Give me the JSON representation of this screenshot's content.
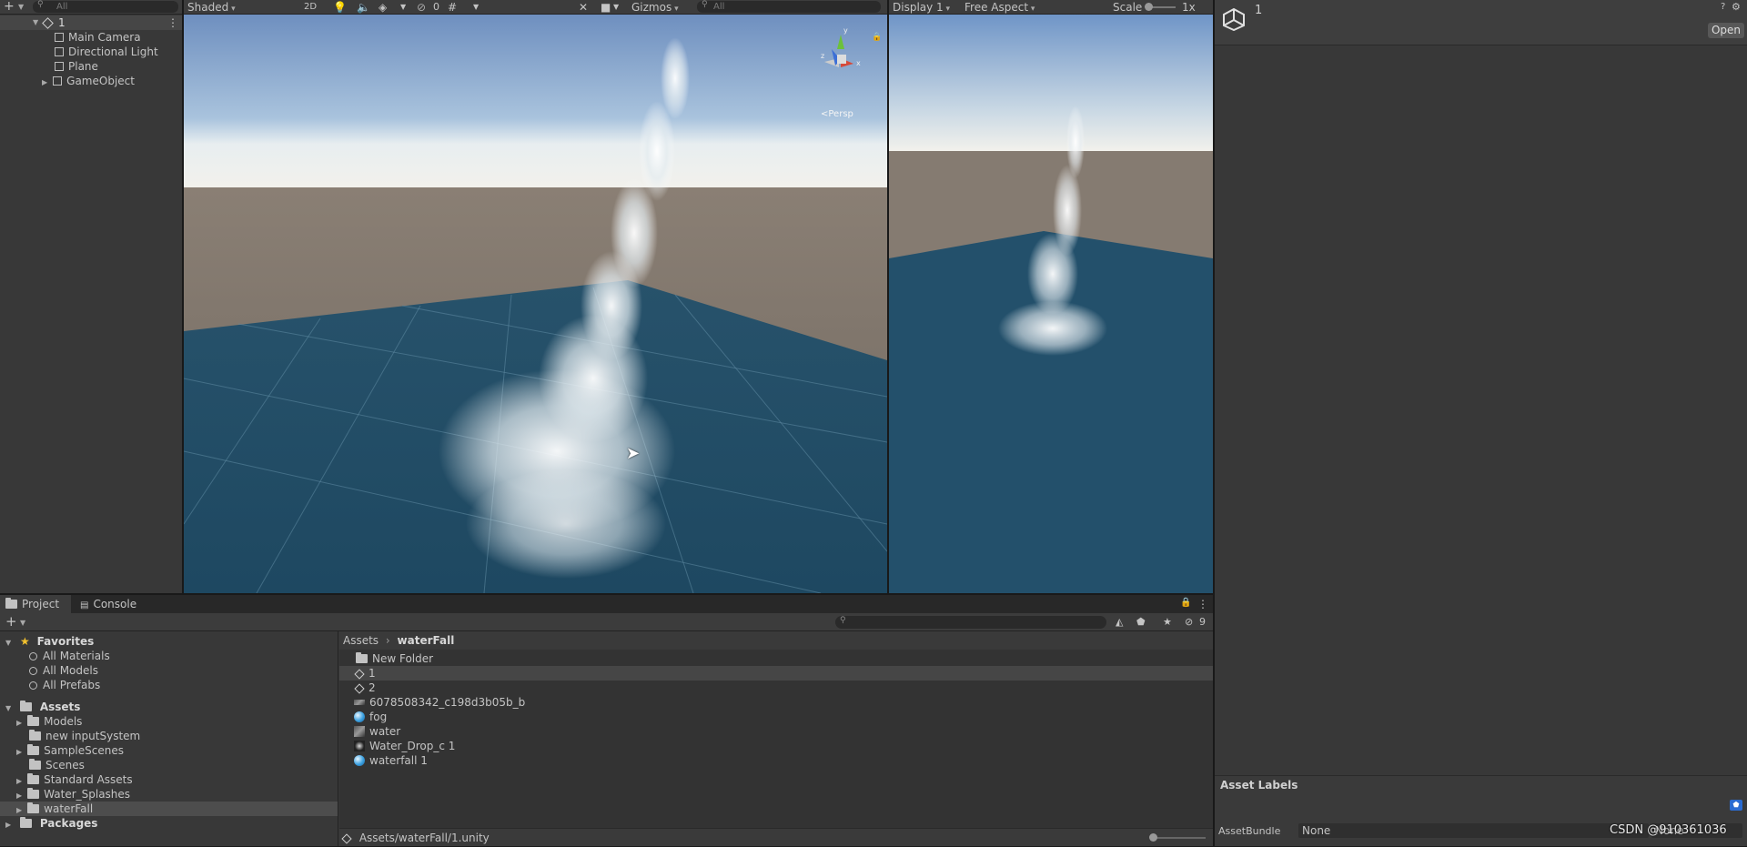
{
  "hierarchy": {
    "search_placeholder": "All",
    "scene_name": "1",
    "items": [
      {
        "label": "Main Camera"
      },
      {
        "label": "Directional Light"
      },
      {
        "label": "Plane"
      },
      {
        "label": "GameObject"
      }
    ]
  },
  "scene_view": {
    "shading_mode": "Shaded",
    "mode_2d": "2D",
    "hidden_count": "0",
    "gizmos_label": "Gizmos",
    "search_placeholder": "All",
    "gizmo_label": "<Persp"
  },
  "game_view": {
    "display": "Display 1",
    "aspect": "Free Aspect",
    "scale_label": "Scale",
    "scale_value": "1x"
  },
  "inspector": {
    "title": "1",
    "open_button": "Open",
    "asset_labels": "Asset Labels",
    "asset_bundle_label": "AssetBundle",
    "asset_bundle_value": "None",
    "asset_bundle_variant": "None"
  },
  "bottom": {
    "tabs": [
      {
        "label": "Project"
      },
      {
        "label": "Console"
      }
    ],
    "hidden_count": "9",
    "breadcrumb": {
      "root": "Assets",
      "current": "waterFall"
    },
    "favorites": {
      "label": "Favorites",
      "items": [
        {
          "label": "All Materials"
        },
        {
          "label": "All Models"
        },
        {
          "label": "All Prefabs"
        }
      ]
    },
    "assets": {
      "label": "Assets",
      "items": [
        {
          "label": "Models"
        },
        {
          "label": "new inputSystem"
        },
        {
          "label": "SampleScenes"
        },
        {
          "label": "Scenes"
        },
        {
          "label": "Standard Assets"
        },
        {
          "label": "Water_Splashes"
        },
        {
          "label": "waterFall"
        }
      ]
    },
    "packages_label": "Packages",
    "files": [
      {
        "label": "New Folder"
      },
      {
        "label": "1"
      },
      {
        "label": "2"
      },
      {
        "label": "6078508342_c198d3b05b_b"
      },
      {
        "label": "fog"
      },
      {
        "label": "water"
      },
      {
        "label": "Water_Drop_c 1"
      },
      {
        "label": "waterfall 1"
      }
    ],
    "status_path": "Assets/waterFall/1.unity"
  },
  "watermark": "CSDN @910361036",
  "colors": {
    "selection": "#2d5a88",
    "panel": "#383838",
    "toolbar": "#3c3c3c"
  }
}
